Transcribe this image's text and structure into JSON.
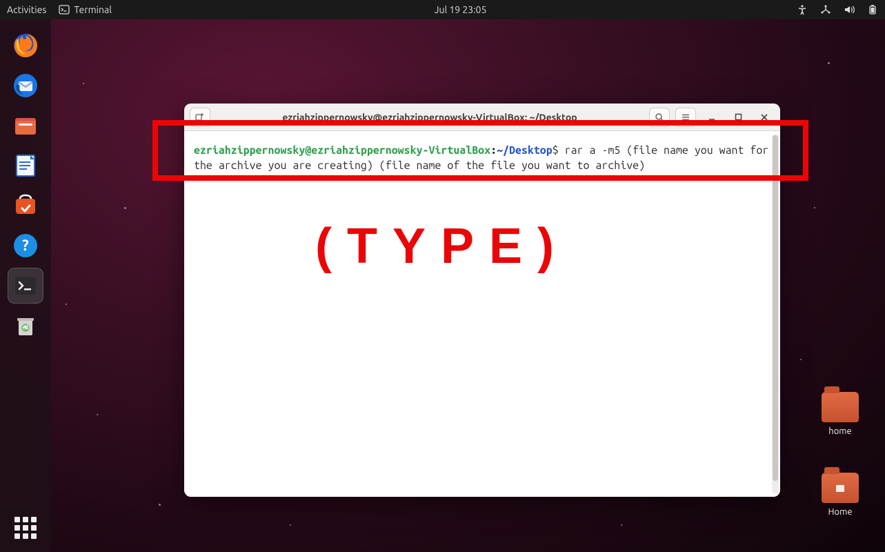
{
  "topbar": {
    "activities": "Activities",
    "app_indicator": "Terminal",
    "clock": "Jul 19  23:05"
  },
  "dock": {
    "items": [
      {
        "name": "firefox-icon"
      },
      {
        "name": "thunderbird-icon"
      },
      {
        "name": "files-icon"
      },
      {
        "name": "libreoffice-writer-icon"
      },
      {
        "name": "ubuntu-software-icon"
      },
      {
        "name": "help-icon"
      },
      {
        "name": "terminal-icon",
        "active": true
      },
      {
        "name": "trash-icon"
      }
    ]
  },
  "desktop_icons": [
    {
      "label": "home"
    },
    {
      "label": "Home"
    }
  ],
  "terminal": {
    "title": "ezriahzippernowsky@ezriahzippernowsky-VirtualBox: ~/Desktop",
    "prompt_user_host": "ezriahzippernowsky@ezriahzippernowsky-VirtualBox",
    "prompt_sep": ":",
    "prompt_path": "~/Desktop",
    "prompt_symbol": "$",
    "command": " rar a -m5 (file name you want for the archive you are creating) (file name of the file you want to archive)"
  },
  "annotation": {
    "label": "(TYPE)"
  }
}
